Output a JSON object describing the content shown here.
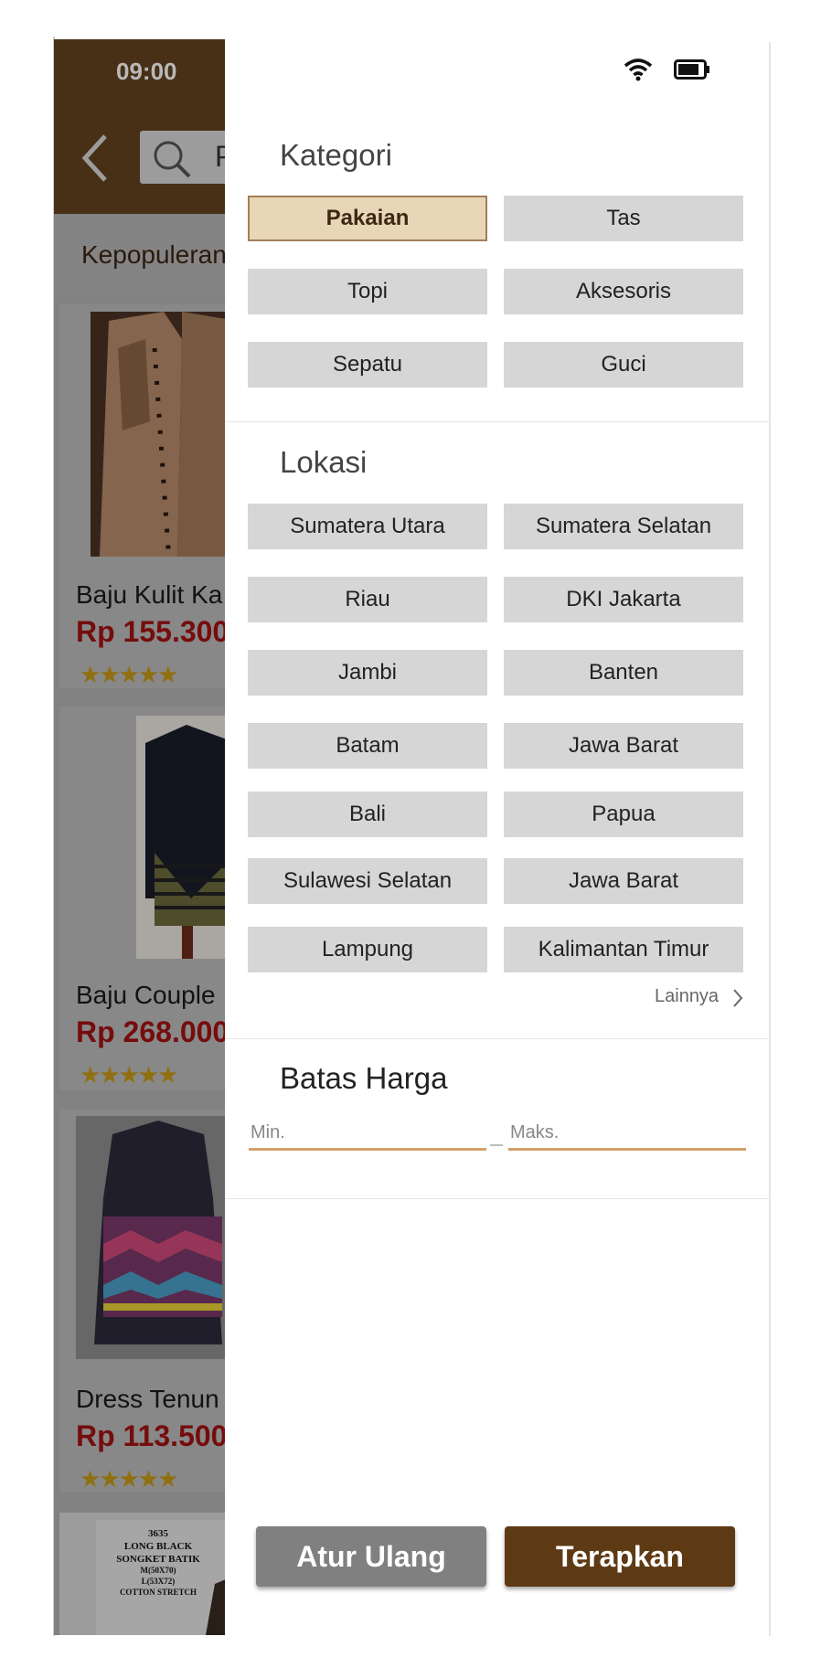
{
  "status_bar": {
    "time": "09:00"
  },
  "app": {
    "search_query": "P",
    "sort_label": "Kepopuleran",
    "products": [
      {
        "name": "Baju Kulit Ka",
        "price": "Rp 155.300",
        "rating": 5
      },
      {
        "name": "Baju Couple",
        "price": "Rp 268.000",
        "rating": 5
      },
      {
        "name": "Dress Tenun",
        "price": "Rp 113.500",
        "rating": 5
      },
      {
        "image_text": "3635 LONG BLACK SONGKET BATIK M(50X70) L(53X72) COTTON STRETCH"
      }
    ]
  },
  "filter": {
    "category": {
      "title": "Kategori",
      "selected": "Pakaian",
      "items": [
        "Pakaian",
        "Tas",
        "Topi",
        "Aksesoris",
        "Sepatu",
        "Guci"
      ]
    },
    "location": {
      "title": "Lokasi",
      "items": [
        "Sumatera Utara",
        "Sumatera Selatan",
        "Riau",
        "DKI Jakarta",
        "Jambi",
        "Banten",
        "Batam",
        "Jawa Barat",
        "Bali",
        "Papua",
        "Sulawesi Selatan",
        "Jawa Barat",
        "Lampung",
        "Kalimantan Timur"
      ],
      "more_label": "Lainnya"
    },
    "price": {
      "title": "Batas Harga",
      "min_placeholder": "Min.",
      "max_placeholder": "Maks."
    },
    "buttons": {
      "reset": "Atur Ulang",
      "apply": "Terapkan"
    }
  },
  "colors": {
    "brand_brown": "#63431f",
    "apply_button": "#5e3a14",
    "selected_chip": "#e8d7b7",
    "price_red": "#a31212",
    "star_gold": "#c89a17",
    "input_underline": "#d2a16c"
  }
}
